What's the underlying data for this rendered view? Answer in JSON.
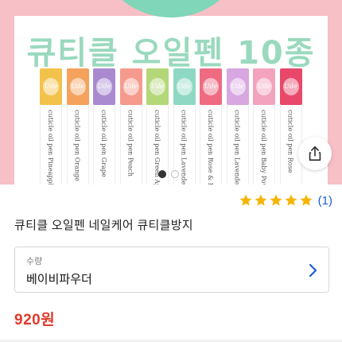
{
  "hero": {
    "title": "큐티클 오일펜 10종",
    "pens": [
      {
        "cap_color": "#f3c24b",
        "logo": "Ude",
        "label": "cuticle oil pen Pineapple"
      },
      {
        "cap_color": "#f5a25c",
        "logo": "Ude",
        "label": "cuticle oil pen Orange"
      },
      {
        "cap_color": "#a98ad0",
        "logo": "Ude",
        "label": "cuticle oil pen Grape"
      },
      {
        "cap_color": "#f59a8c",
        "logo": "Ude",
        "label": "cuticle oil pen Peach"
      },
      {
        "cap_color": "#b4d77a",
        "logo": "Ude",
        "label": "cuticle oil pen Green Apple"
      },
      {
        "cap_color": "#8fd9c4",
        "logo": "Ude",
        "label": "cuticle oil pen Lavender"
      },
      {
        "cap_color": "#ee6b82",
        "logo": "Ude",
        "label": "cuticle oil pen Rose & Berry"
      },
      {
        "cap_color": "#d8a6e0",
        "logo": "Ude",
        "label": "cuticle oil pen Lavender"
      },
      {
        "cap_color": "#f3a3bd",
        "logo": "Ude",
        "label": "cuticle oil pen Baby Powder"
      },
      {
        "cap_color": "#e8486a",
        "logo": "Ude",
        "label": "cuticle oil pen Rose"
      }
    ],
    "carousel_total": 2,
    "carousel_active": 1
  },
  "rating": {
    "stars": 5,
    "review_count": "(1)",
    "star_color": "#f5b400"
  },
  "product": {
    "title": "큐티클 오일펜 네일케어 큐티클방지"
  },
  "option": {
    "label": "수량",
    "value": "베이비파우더"
  },
  "price": "920원",
  "colors": {
    "accent_link": "#1a5fd6",
    "price_red": "#e0392a",
    "hero_pink": "#f7bfc6",
    "hero_mint": "#7fd6b8"
  },
  "icons": {
    "share": "share-icon",
    "option_arrow": "chevron-right-icon",
    "star": "star-icon"
  }
}
